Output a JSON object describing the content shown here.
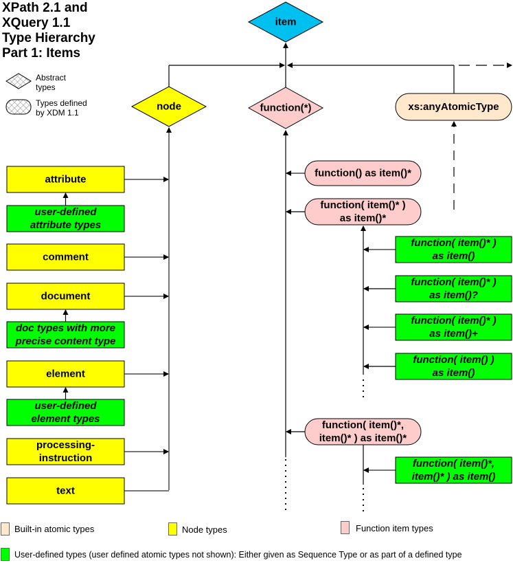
{
  "title": [
    "XPath 2.1 and",
    "XQuery 1.1",
    "Type Hierarchy",
    "Part 1: Items"
  ],
  "shape_legend": {
    "abstract": [
      "Abstract",
      "types"
    ],
    "xdm": [
      "Types defined",
      "by XDM 1.1"
    ]
  },
  "colors": {
    "abstract_root": "#00C0F0",
    "node": "#FFFF00",
    "function": "#FFCCCC",
    "atomic": "#FFE8CC",
    "user_defined": "#00FF00"
  },
  "abstract_nodes": {
    "item": "item",
    "node": "node",
    "function": "function(*)"
  },
  "atomic_node": "xs:anyAtomicType",
  "node_types": [
    {
      "label": [
        "attribute"
      ],
      "subtype": [
        "user-defined",
        "attribute types"
      ]
    },
    {
      "label": [
        "comment"
      ]
    },
    {
      "label": [
        "document"
      ],
      "subtype": [
        "doc types with more",
        "precise content type"
      ]
    },
    {
      "label": [
        "element"
      ],
      "subtype": [
        "user-defined",
        "element types"
      ]
    },
    {
      "label": [
        "processing-",
        "instruction"
      ]
    },
    {
      "label": [
        "text"
      ]
    }
  ],
  "function_types": [
    {
      "label": [
        "function() as item()*"
      ]
    },
    {
      "label": [
        "function( item()* )",
        "as item()*"
      ],
      "subtypes": [
        [
          "function( item()* )",
          "as item()"
        ],
        [
          "function( item()* )",
          "as item()?"
        ],
        [
          "function( item()* )",
          "as item()+"
        ],
        [
          "function( item() )",
          "as item()"
        ]
      ]
    },
    {
      "label": [
        "function( item()*,",
        "item()* ) as item()*"
      ],
      "subtypes": [
        [
          "function( item()*,",
          "item()* ) as item()"
        ]
      ]
    }
  ],
  "bottom_legend": {
    "atomic": "Built-in atomic types",
    "node": "Node types",
    "function": "Function item types",
    "user_defined": "User-defined types (user defined atomic types not shown):  Either given as Sequence Type or as part of a defined type"
  }
}
